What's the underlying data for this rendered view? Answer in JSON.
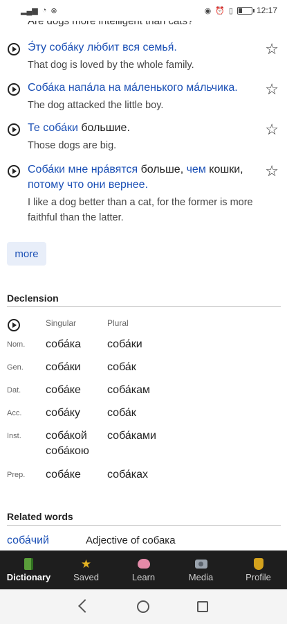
{
  "status_bar": {
    "time": "12:17"
  },
  "cut_off_text": "Are dogs more intelligent than cats?",
  "examples": [
    {
      "ru_parts": [
        {
          "text": "Э́ту соба́ку лю́бит вся семья́.",
          "link": true
        }
      ],
      "en": "That dog is loved by the whole family."
    },
    {
      "ru_parts": [
        {
          "text": "Соба́ка напа́ла на ма́ленького ма́льчика.",
          "link": true
        }
      ],
      "en": "The dog attacked the little boy."
    },
    {
      "ru_parts": [
        {
          "text": "Те соба́ки",
          "link": true
        },
        {
          "text": " большие.",
          "link": false
        }
      ],
      "en": "Those dogs are big."
    },
    {
      "ru_parts": [
        {
          "text": "Соба́ки мне нра́вятся",
          "link": true
        },
        {
          "text": " больше, ",
          "link": false
        },
        {
          "text": "чем",
          "link": true
        },
        {
          "text": " кошки, ",
          "link": false
        },
        {
          "text": "потому что они вернее.",
          "link": true
        }
      ],
      "en": "I like a dog better than a cat, for the former is more faithful than the latter."
    }
  ],
  "more_label": "more",
  "declension": {
    "title": "Declension",
    "col_singular": "Singular",
    "col_plural": "Plural",
    "rows": [
      {
        "case": "Nom.",
        "singular": "соба́ка",
        "plural": "соба́ки"
      },
      {
        "case": "Gen.",
        "singular": "соба́ки",
        "plural": "соба́к"
      },
      {
        "case": "Dat.",
        "singular": "соба́ке",
        "plural": "соба́кам"
      },
      {
        "case": "Acc.",
        "singular": "соба́ку",
        "plural": "соба́к"
      },
      {
        "case": "Inst.",
        "singular": "соба́кой\nсоба́кою",
        "plural": "соба́ками"
      },
      {
        "case": "Prep.",
        "singular": "соба́ке",
        "plural": "соба́ках"
      }
    ]
  },
  "related": {
    "title": "Related words",
    "items": [
      {
        "word": "соба́чий",
        "definition": "Adjective of собака"
      }
    ]
  },
  "bottom_nav": [
    {
      "label": "Dictionary",
      "icon": "book-icon",
      "active": true
    },
    {
      "label": "Saved",
      "icon": "star-icon",
      "active": false
    },
    {
      "label": "Learn",
      "icon": "brain-icon",
      "active": false
    },
    {
      "label": "Media",
      "icon": "camera-icon",
      "active": false
    },
    {
      "label": "Profile",
      "icon": "badge-icon",
      "active": false
    }
  ],
  "colors": {
    "link": "#1a4fb5",
    "nav_bg": "#1e1e1e",
    "more_bg": "#e8eef9"
  }
}
